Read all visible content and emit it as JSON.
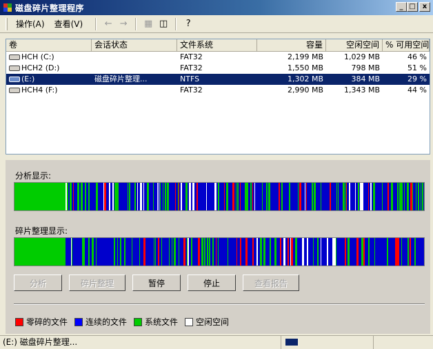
{
  "window": {
    "title": "磁盘碎片整理程序",
    "minimize": "_",
    "maximize": "□",
    "close": "x"
  },
  "menu": {
    "action": "操作(A)",
    "view": "查看(V)"
  },
  "toolbar": {
    "back": "←",
    "forward": "→",
    "icon1": "▦",
    "icon2": "◫",
    "help": "?"
  },
  "columns": [
    "卷",
    "会话状态",
    "文件系统",
    "容量",
    "空闲空间",
    "% 可用空间"
  ],
  "volumes": [
    {
      "name": "HCH (C:)",
      "status": "",
      "fs": "FAT32",
      "capacity": "2,199 MB",
      "free": "1,029 MB",
      "pct": "46 %",
      "selected": false
    },
    {
      "name": "HCH2 (D:)",
      "status": "",
      "fs": "FAT32",
      "capacity": "1,550 MB",
      "free": "798 MB",
      "pct": "51 %",
      "selected": false
    },
    {
      "name": "(E:)",
      "status": "磁盘碎片整理...",
      "fs": "NTFS",
      "capacity": "1,302 MB",
      "free": "384 MB",
      "pct": "29 %",
      "selected": true
    },
    {
      "name": "HCH4 (F:)",
      "status": "",
      "fs": "FAT32",
      "capacity": "2,990 MB",
      "free": "1,343 MB",
      "pct": "44 %",
      "selected": false
    }
  ],
  "analysis_label": "分析显示:",
  "defrag_label": "碎片整理显示:",
  "buttons": {
    "analyze": "分析",
    "defrag": "碎片整理",
    "pause": "暂停",
    "stop": "停止",
    "report": "查看报告"
  },
  "legend": [
    {
      "label": "零碎的文件",
      "color": "#ff0000"
    },
    {
      "label": "连续的文件",
      "color": "#0000ff"
    },
    {
      "label": "系统文件",
      "color": "#00cc00"
    },
    {
      "label": "空闲空间",
      "color": "#ffffff"
    }
  ],
  "status": {
    "text": "(E:) 磁盘碎片整理..."
  },
  "colors": {
    "fragmented": "#ff0000",
    "contiguous": "#0000cc",
    "system": "#00cc00",
    "free": "#ffffff"
  }
}
